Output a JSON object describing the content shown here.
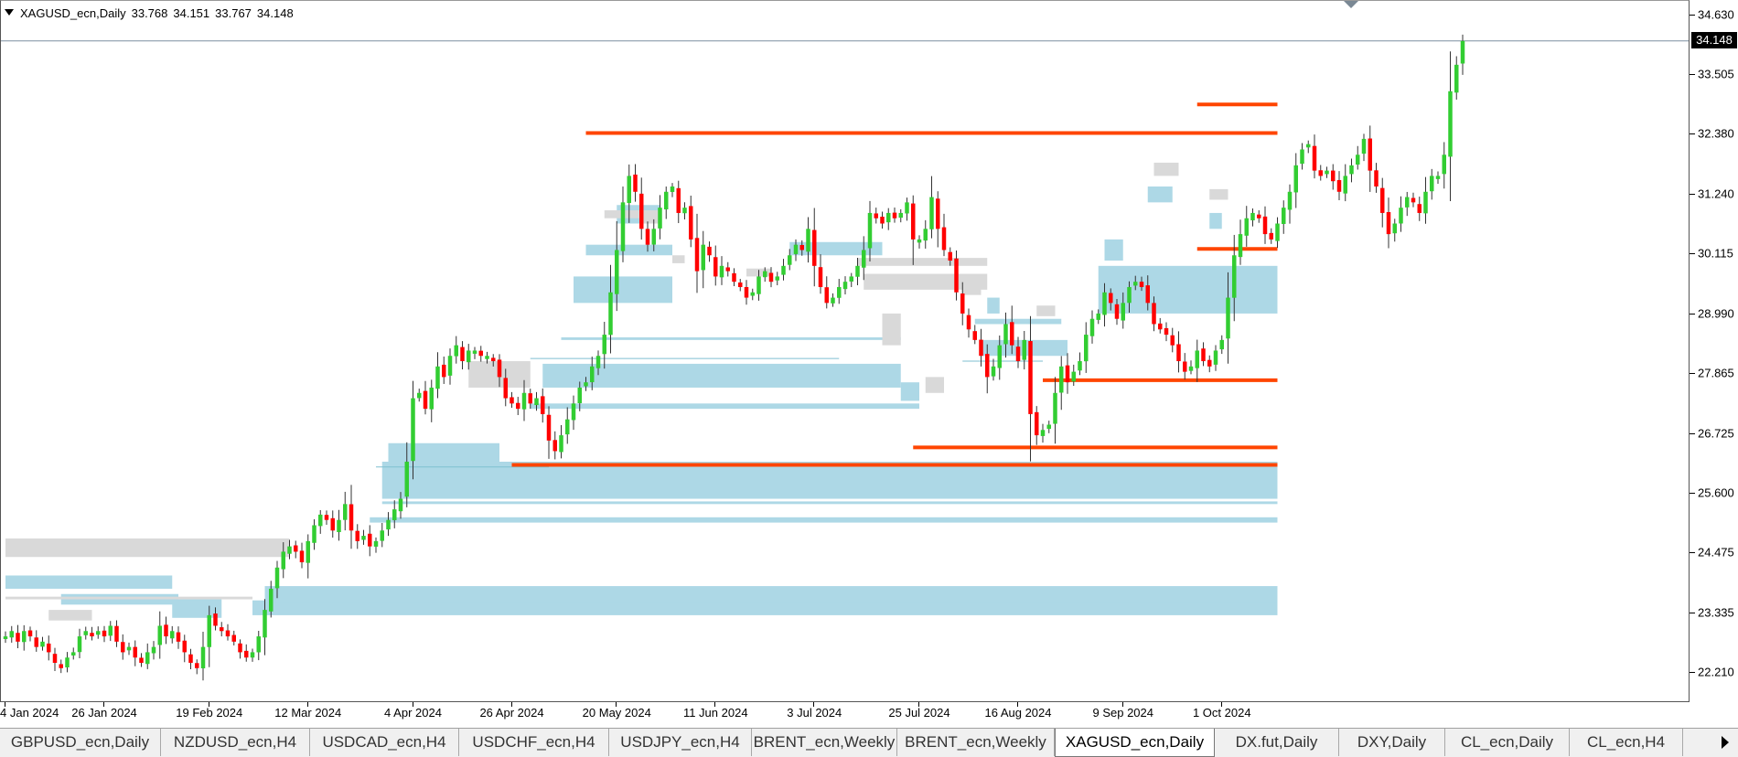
{
  "header": {
    "symbol": "XAGUSD_ecn,Daily",
    "open": "33.768",
    "high": "34.151",
    "low": "33.767",
    "close": "34.148"
  },
  "current_price_label": "34.148",
  "price_axis": {
    "labels": [
      "34.630",
      "33.505",
      "32.380",
      "31.240",
      "30.115",
      "28.990",
      "27.865",
      "26.725",
      "25.600",
      "24.475",
      "23.335",
      "22.210"
    ],
    "values": [
      34.63,
      33.505,
      32.38,
      31.24,
      30.115,
      28.99,
      27.865,
      26.725,
      25.6,
      24.475,
      23.335,
      22.21
    ]
  },
  "time_axis": {
    "labels": [
      "4 Jan 2024",
      "26 Jan 2024",
      "19 Feb 2024",
      "12 Mar 2024",
      "4 Apr 2024",
      "26 Apr 2024",
      "20 May 2024",
      "11 Jun 2024",
      "3 Jul 2024",
      "25 Jul 2024",
      "16 Aug 2024",
      "9 Sep 2024",
      "1 Oct 2024"
    ],
    "bar_index": [
      0,
      16,
      33,
      49,
      66,
      82,
      99,
      115,
      131,
      148,
      164,
      181,
      197
    ]
  },
  "tabs": [
    {
      "label": "GBPUSD_ecn,Daily",
      "active": false
    },
    {
      "label": "NZDUSD_ecn,H4",
      "active": false
    },
    {
      "label": "USDCAD_ecn,H4",
      "active": false
    },
    {
      "label": "USDCHF_ecn,H4",
      "active": false
    },
    {
      "label": "USDJPY_ecn,H4",
      "active": false
    },
    {
      "label": "BRENT_ecn,Weekly",
      "active": false
    },
    {
      "label": "BRENT_ecn,Weekly",
      "active": false
    },
    {
      "label": "XAGUSD_ecn,Daily",
      "active": true
    },
    {
      "label": "DX.fut,Daily",
      "active": false
    },
    {
      "label": "DXY,Daily",
      "active": false
    },
    {
      "label": "CL_ecn,Daily",
      "active": false
    },
    {
      "label": "CL_ecn,H4",
      "active": false
    }
  ],
  "colors": {
    "bull": "#32cd32",
    "bear": "#ff0000",
    "level_line": "#ff4500",
    "demand_zone": "#add8e6",
    "supply_zone": "#d9d9d9",
    "wick": "#333333"
  },
  "chart_data": {
    "type": "candlestick",
    "symbol": "XAGUSD_ecn",
    "timeframe": "Daily",
    "ylim": [
      21.8,
      34.9
    ],
    "closes": [
      22.9,
      23.0,
      22.8,
      23.0,
      22.9,
      22.7,
      22.8,
      22.6,
      22.4,
      22.3,
      22.5,
      22.6,
      22.9,
      23.0,
      22.9,
      23.0,
      22.9,
      23.1,
      22.8,
      22.6,
      22.7,
      22.5,
      22.4,
      22.6,
      22.7,
      23.1,
      22.9,
      23.0,
      22.8,
      22.6,
      22.4,
      22.3,
      22.7,
      23.3,
      23.1,
      23.0,
      22.9,
      22.8,
      22.6,
      22.5,
      22.6,
      22.9,
      23.4,
      23.8,
      24.2,
      24.5,
      24.6,
      24.5,
      24.3,
      24.7,
      25.0,
      25.2,
      25.1,
      24.9,
      25.1,
      25.4,
      24.9,
      24.7,
      24.8,
      24.6,
      24.7,
      24.9,
      25.1,
      25.3,
      25.5,
      26.2,
      27.4,
      27.5,
      27.2,
      27.6,
      28.0,
      27.8,
      28.2,
      28.4,
      28.1,
      28.3,
      28.3,
      28.2,
      28.2,
      28.1,
      27.8,
      27.4,
      27.3,
      27.2,
      27.5,
      27.3,
      27.4,
      27.1,
      26.6,
      26.4,
      26.7,
      27.0,
      27.3,
      27.6,
      27.7,
      28.0,
      28.2,
      28.6,
      29.4,
      30.2,
      31.1,
      31.6,
      31.3,
      30.6,
      30.3,
      30.6,
      31.0,
      31.3,
      31.4,
      30.9,
      31.0,
      30.4,
      29.8,
      30.3,
      30.1,
      29.7,
      29.9,
      29.8,
      29.6,
      29.5,
      29.3,
      29.4,
      29.7,
      29.8,
      29.6,
      29.7,
      29.9,
      30.1,
      30.3,
      30.2,
      30.6,
      29.9,
      29.5,
      29.2,
      29.3,
      29.5,
      29.6,
      29.7,
      29.9,
      30.2,
      30.9,
      30.8,
      30.7,
      30.9,
      30.8,
      30.9,
      31.1,
      30.4,
      30.4,
      30.6,
      31.2,
      30.6,
      30.2,
      30.0,
      29.4,
      29.0,
      28.7,
      28.5,
      28.2,
      27.8,
      28.0,
      28.4,
      28.8,
      28.4,
      28.1,
      28.5,
      27.1,
      26.7,
      26.8,
      26.9,
      27.5,
      28.0,
      27.7,
      27.9,
      28.1,
      28.6,
      28.9,
      29.0,
      29.4,
      29.2,
      28.9,
      29.2,
      29.5,
      29.6,
      29.5,
      29.2,
      28.8,
      28.7,
      28.6,
      28.4,
      28.1,
      27.9,
      28.0,
      28.3,
      28.1,
      28.0,
      28.3,
      28.5,
      29.3,
      30.1,
      30.5,
      30.8,
      30.9,
      30.8,
      30.5,
      30.4,
      30.7,
      31.0,
      31.3,
      31.8,
      32.1,
      32.2,
      31.7,
      31.6,
      31.7,
      31.5,
      31.3,
      31.6,
      31.8,
      32.0,
      32.3,
      31.7,
      31.4,
      30.9,
      30.5,
      30.7,
      31.0,
      31.2,
      31.1,
      30.9,
      31.3,
      31.6,
      31.6,
      32.0,
      33.2,
      33.7,
      34.15
    ]
  }
}
